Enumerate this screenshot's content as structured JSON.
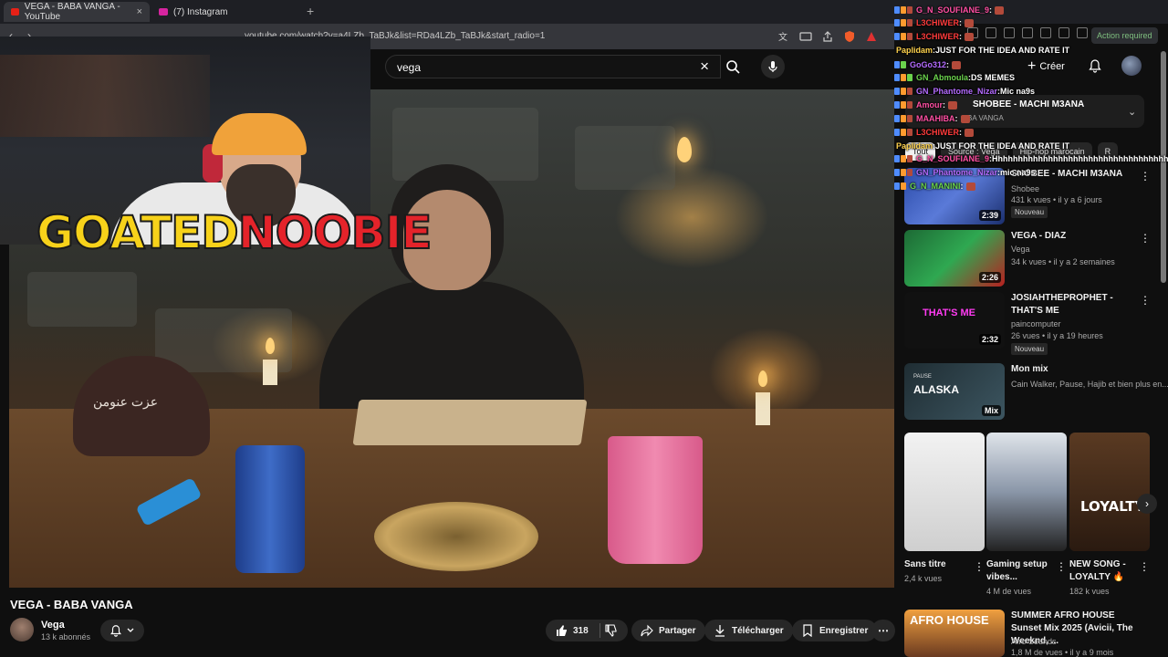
{
  "browser": {
    "tabs": [
      {
        "title": "VEGA - BABA VANGA - YouTube",
        "active": true,
        "favicon_color": "#e62117"
      },
      {
        "title": "(7) Instagram",
        "active": false,
        "favicon_color": "#d6249f"
      }
    ],
    "new_tab_glyph": "+",
    "close_glyph": "×",
    "url": "youtube.com/watch?v=a4LZb_TaBJk&list=RDa4LZb_TaBJk&start_radio=1"
  },
  "youtube": {
    "search": {
      "query": "vega",
      "clear_glyph": "×"
    },
    "header": {
      "create_label": "Créer"
    },
    "video": {
      "title": "VEGA - BABA VANGA",
      "channel": "Vega",
      "subscribers": "13 k abonnés",
      "likes": "318",
      "share_label": "Partager",
      "download_label": "Télécharger",
      "save_label": "Enregistrer"
    },
    "now_playing": {
      "title": "SHOBEE - MACHI M3ANA",
      "subtitle": "BA VANGA"
    },
    "chips": [
      "Tout",
      "Source : Vega",
      "Hip-hop marocain",
      "R"
    ],
    "recommendations": [
      {
        "title": "SHOBEE - MACHI M3ANA",
        "channel": "Shobee",
        "meta": "431 k vues • il y a 6 jours",
        "duration": "2:39",
        "badge": "Nouveau"
      },
      {
        "title": "VEGA - DIAZ",
        "channel": "Vega",
        "meta": "34 k vues • il y a 2 semaines",
        "duration": "2:26",
        "badge": ""
      },
      {
        "title": "JOSIAHTHEPROPHET - THAT'S ME",
        "channel": "paincomputer",
        "meta": "26 vues • il y a 19 heures",
        "duration": "2:32",
        "badge": "Nouveau"
      },
      {
        "title": "Mon mix",
        "channel": "Cain Walker, Pause, Hajib et bien plus en...",
        "meta": "",
        "duration": "Mix",
        "badge": ""
      }
    ],
    "shorts": [
      {
        "title": "Sans titre",
        "views": "2,4 k vues"
      },
      {
        "title": "Gaming setup vibes...",
        "views": "4 M de vues"
      },
      {
        "title": "NEW SONG - LOYALTY 🔥",
        "views": "182 k vues"
      }
    ],
    "bottom_rec": {
      "title": "SUMMER AFRO HOUSE Sunset Mix 2025 (Avicii, The Weeknd, ...",
      "channel": "Afro Sounds",
      "meta": "1,8 M de vues • il y a 9 mois",
      "thumb_text": "AFRO HOUSE"
    },
    "thumb_texts": {
      "mix_label": "PAUSE",
      "mix_title": "ALASKA",
      "loyalty": "LOYALTY",
      "thats_me": "THAT'S ME"
    }
  },
  "overlay": {
    "streamer_logo_part1": "GOATED",
    "streamer_logo_part2": "NOOBIE",
    "cap_text": "عزت عنومن"
  },
  "extension": {
    "action_required": "Action required"
  },
  "chat": [
    {
      "user": "G_N_SOUFIANE_9",
      "msg": "",
      "color": "#ff4fa3"
    },
    {
      "user": "L3CHIWER",
      "msg": "",
      "color": "#ff3b3b"
    },
    {
      "user": "L3CHIWER",
      "msg": "",
      "color": "#ff3b3b"
    },
    {
      "user": "Paplidam",
      "msg": "JUST FOR THE IDEA AND RATE IT",
      "color": "#ffd34d"
    },
    {
      "user": "GoGo312",
      "msg": "",
      "color": "#b46bff"
    },
    {
      "user": "GN_Abmoula",
      "msg": "DS MEMES",
      "color": "#6bd34d"
    },
    {
      "user": "GN_Phantome_Nizar",
      "msg": "Mic na9s",
      "color": "#b46bff"
    },
    {
      "user": "Amour",
      "msg": "",
      "color": "#ff4fa3"
    },
    {
      "user": "MAAHIBA",
      "msg": "",
      "color": "#ff4fa3"
    },
    {
      "user": "L3CHIWER",
      "msg": "",
      "color": "#ff3b3b"
    },
    {
      "user": "Paplidam",
      "msg": "JUST FOR THE IDEA AND RATE IT",
      "color": "#ffd34d"
    },
    {
      "user": "G_N_SOUFIANE_9",
      "msg": "Hhhhhhhhhhhhhhhhhhhhhhhhhhhhhhhhhhhhhhhhhh",
      "color": "#ff4fa3"
    },
    {
      "user": "GN_Phantome_Nizar",
      "msg": "mic na9s",
      "color": "#b46bff"
    },
    {
      "user": "G_N_MANINI",
      "msg": "",
      "color": "#6bd34d"
    }
  ]
}
